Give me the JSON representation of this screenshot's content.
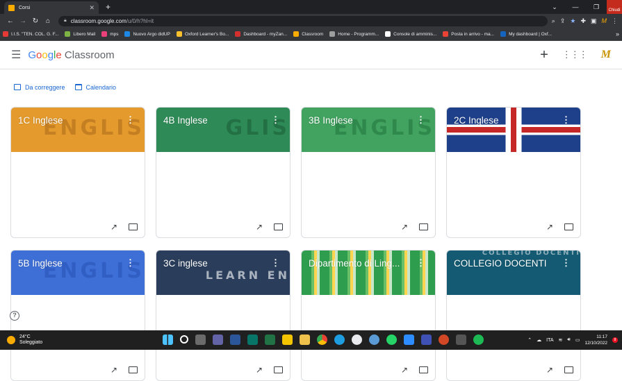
{
  "browser": {
    "tab_title": "Corsi",
    "new_tab": "+",
    "close_tooltip": "Chiudi",
    "url_host": "classroom.google.com",
    "url_path": "/u/0/h?hl=it",
    "controls": {
      "minimize": "—",
      "maximize": "❐",
      "dropdown": "⌄"
    }
  },
  "bookmarks": [
    {
      "label": "I.I.S. \"TEN. COL. G. F...",
      "color": "#e53935"
    },
    {
      "label": "Libero Mail",
      "color": "#7cb342"
    },
    {
      "label": "mps",
      "color": "#ec407a"
    },
    {
      "label": "Nuovo Argo didUP",
      "color": "#1e88e5"
    },
    {
      "label": "Oxford Learner's Bo...",
      "color": "#fbc02d"
    },
    {
      "label": "Dashboard - myZan...",
      "color": "#d32f2f"
    },
    {
      "label": "Classroom",
      "color": "#f9ab00"
    },
    {
      "label": "Home - Programm...",
      "color": "#9e9e9e"
    },
    {
      "label": "Console di amminis...",
      "color": "#ffffff"
    },
    {
      "label": "Posta in arrivo - ma...",
      "color": "#ea4335"
    },
    {
      "label": "My dashboard | Oxf...",
      "color": "#1565c0"
    }
  ],
  "header": {
    "logo_google": "Google",
    "logo_product": "Classroom"
  },
  "quicklinks": {
    "to_grade": "Da correggere",
    "calendar": "Calendario"
  },
  "courses": [
    {
      "title": "1C Inglese",
      "color": "#e49a2c",
      "deco": "ENGLIS",
      "deco_color": "#8a4f10"
    },
    {
      "title": "4B Inglese",
      "color": "#2e8b57",
      "deco": "GLIS",
      "deco_color": "#0d3f22"
    },
    {
      "title": "3B Inglese",
      "color": "#41a35f",
      "deco": "ENGLIS",
      "deco_color": "#0f5a2b"
    },
    {
      "title": "2C Inglese",
      "color": "#1e3f8a",
      "deco": "",
      "deco_color": "#c62828"
    },
    {
      "title": "5B Inglese",
      "color": "#3d6fd6",
      "deco": "ENGLIS",
      "deco_color": "#1b3fa0"
    },
    {
      "title": "3C inglese",
      "color": "#2a3e5c",
      "deco": "LEARN EN",
      "deco_color": "#ffffff"
    },
    {
      "title": "Dipartimento di Ling...",
      "color": "#2e9e4e",
      "deco": "",
      "deco_color": "#0f5a2b"
    },
    {
      "title": "COLLEGIO DOCENTI",
      "color": "#145a72",
      "deco": "COLLEGIO DOCENTI",
      "deco_color": "#ffffff"
    }
  ],
  "taskbar": {
    "temp": "24°C",
    "weather": "Soleggiato",
    "lang": "ITA",
    "time": "11:17",
    "date": "12/10/2022",
    "notifications": "8"
  }
}
